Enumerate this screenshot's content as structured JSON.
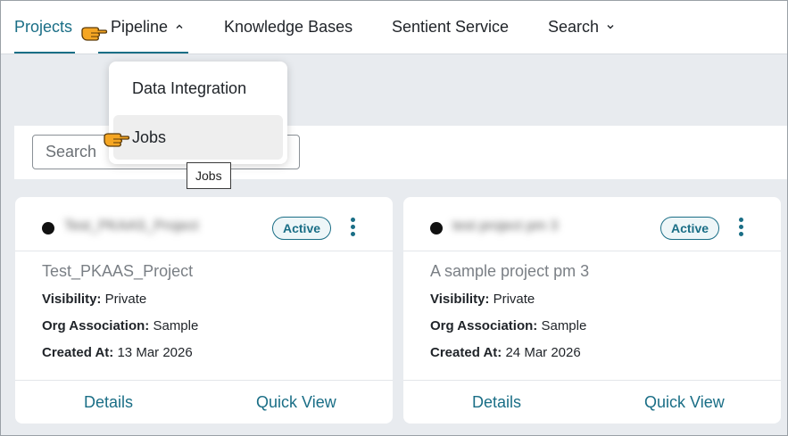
{
  "nav": {
    "projects": "Projects",
    "pipeline": "Pipeline",
    "knowledge_bases": "Knowledge Bases",
    "sentient_service": "Sentient Service",
    "search": "Search"
  },
  "dropdown": {
    "items": [
      "Data Integration",
      "Jobs"
    ],
    "tooltip": "Jobs"
  },
  "search": {
    "placeholder": "Search"
  },
  "cards": [
    {
      "name": "Test_PKAAS_Project",
      "status": "Active",
      "description": "Test_PKAAS_Project",
      "visibility_label": "Visibility:",
      "visibility": "Private",
      "org_label": "Org Association:",
      "org": "Sample",
      "created_label": "Created At:",
      "created": "13 Mar 2026",
      "details": "Details",
      "quick_view": "Quick View"
    },
    {
      "name": "test project pm 3",
      "status": "Active",
      "description": "A sample project pm 3",
      "visibility_label": "Visibility:",
      "visibility": "Private",
      "org_label": "Org Association:",
      "org": "Sample",
      "created_label": "Created At:",
      "created": "24 Mar 2026",
      "details": "Details",
      "quick_view": "Quick View"
    }
  ],
  "colors": {
    "accent": "#1a6e86",
    "background": "#e8ebef",
    "pointer": "#f5a623"
  },
  "icons": [
    "pointing-hand-icon",
    "chevron-up-icon",
    "chevron-down-icon",
    "kebab-menu-icon"
  ]
}
